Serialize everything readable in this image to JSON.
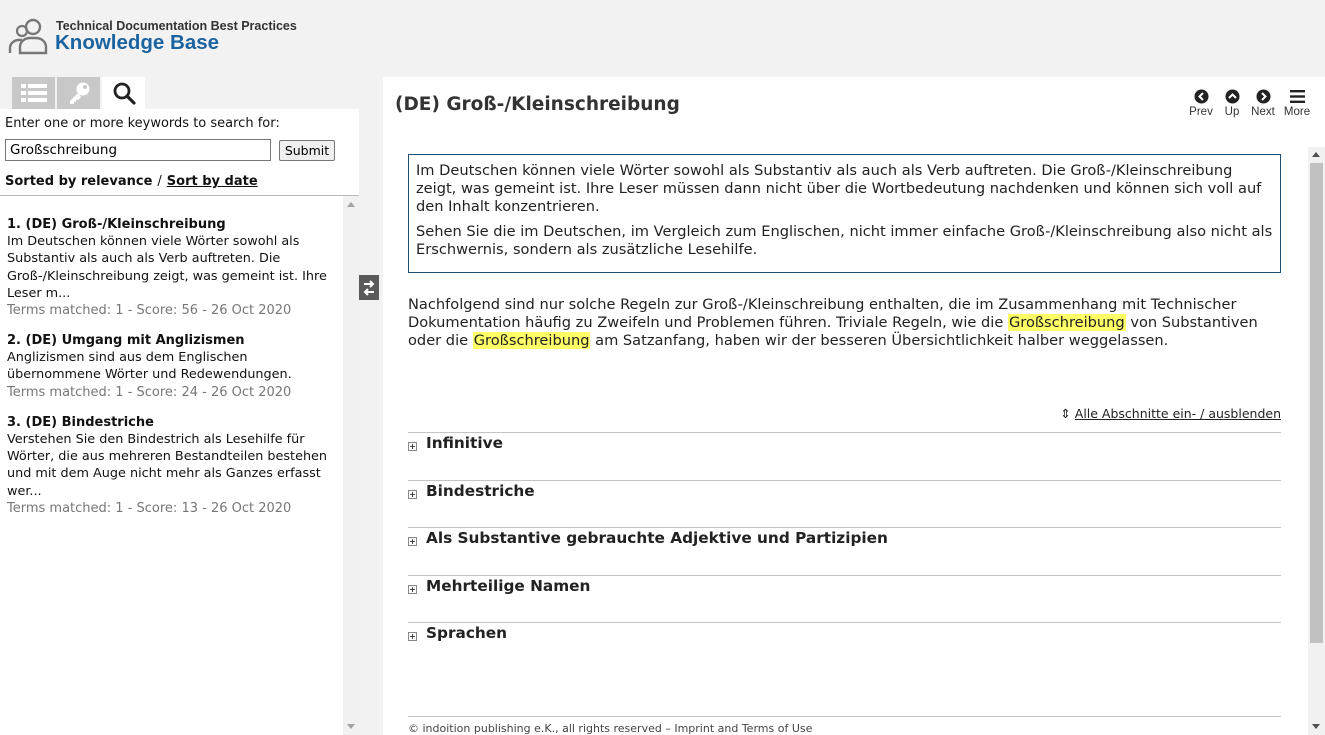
{
  "header": {
    "subtitle": "Technical Documentation Best Practices",
    "title": "Knowledge Base"
  },
  "sidebar": {
    "tabs": [
      {
        "icon": "list-icon",
        "active": false
      },
      {
        "icon": "key-icon",
        "active": false
      },
      {
        "icon": "search-icon",
        "active": true
      }
    ],
    "search_label": "Enter one or more keywords to search for:",
    "search_value": "Großschreibung",
    "submit_label": "Submit",
    "sort_relevance": "Sorted by relevance",
    "sort_separator": "/",
    "sort_date": "Sort by date",
    "results": [
      {
        "title": "1.  (DE) Groß-/Kleinschreibung",
        "description": "Im Deutschen können viele Wörter sowohl als Substantiv als auch als Verb auftreten. Die Groß-/Kleinschreibung zeigt, was gemeint ist. Ihre Leser m...",
        "meta": "Terms matched: 1  -  Score: 56  -  26 Oct 2020"
      },
      {
        "title": "2.  (DE) Umgang mit Anglizismen",
        "description": "Anglizismen sind aus dem Englischen übernommene Wörter und Redewendungen.",
        "meta": "Terms matched: 1  -  Score: 24  -  26 Oct 2020"
      },
      {
        "title": "3.  (DE) Bindestriche",
        "description": "Verstehen Sie den Bindestrich als Lesehilfe für Wörter, die aus mehreren Bestandteilen bestehen und mit dem Auge nicht mehr als Ganzes erfasst wer...",
        "meta": "Terms matched: 1  -  Score: 13  -  26 Oct 2020"
      }
    ]
  },
  "main": {
    "title": "(DE) Groß-/Kleinschreibung",
    "nav": {
      "prev": "Prev",
      "up": "Up",
      "next": "Next",
      "more": "More"
    },
    "intro_p1": "Im Deutschen können viele Wörter sowohl als Substantiv als auch als Verb auftreten. Die Groß-/Kleinschreibung zeigt, was gemeint ist. Ihre Leser müssen dann nicht über die Wortbedeutung nachdenken und können sich voll auf den Inhalt konzentrieren.",
    "intro_p2": "Sehen Sie die im Deutschen, im Vergleich zum Englischen, nicht immer einfache Groß-/Kleinschreibung also nicht als Erschwernis, sondern als zusätzliche Lesehilfe.",
    "body_part1": "Nachfolgend sind nur solche Regeln zur Groß-/Kleinschreibung enthalten, die im Zusammenhang mit Technischer Dokumentation häufig zu Zweifeln und Problemen führen. Triviale Regeln, wie die ",
    "body_highlight1": "Großschreibung",
    "body_part2": " von Substantiven oder die ",
    "body_highlight2": "Großschreibung",
    "body_part3": " am Satzanfang, haben wir der besseren Übersichtlichkeit halber weggelassen.",
    "toggle_all_arrows": "⇕",
    "toggle_all": "Alle Abschnitte ein- / ausblenden",
    "sections": [
      {
        "label": "Infinitive"
      },
      {
        "label": "Bindestriche"
      },
      {
        "label": "Als Substantive gebrauchte Adjektive und Partizipien"
      },
      {
        "label": "Mehrteilige Namen"
      },
      {
        "label": "Sprachen"
      }
    ],
    "footer": "© indoition publishing e.K., all rights reserved – Imprint and Terms of Use"
  },
  "colors": {
    "brand": "#1c64a0",
    "highlight": "#ffff66",
    "box_border": "#1b4f72"
  }
}
